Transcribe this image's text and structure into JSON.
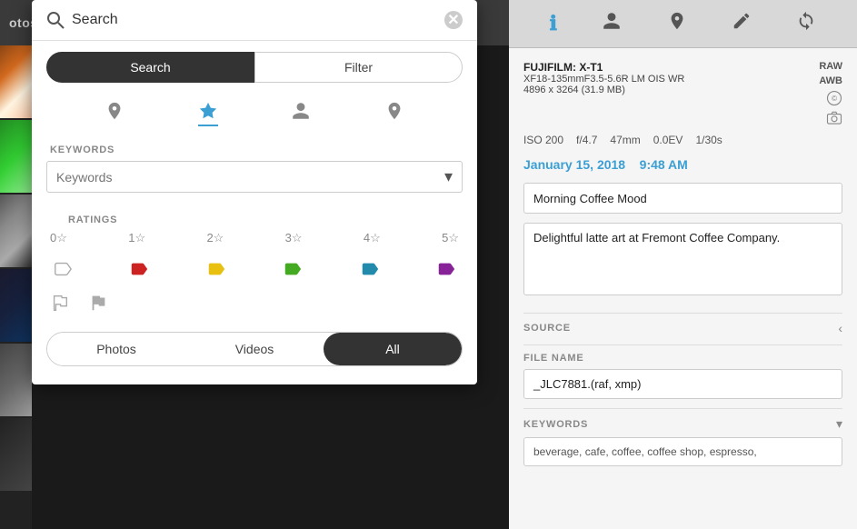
{
  "app": {
    "title": "otos"
  },
  "search_overlay": {
    "placeholder": "Search",
    "tabs": [
      {
        "label": "Search",
        "active": true
      },
      {
        "label": "Filter",
        "active": false
      }
    ],
    "filter_icons": [
      {
        "name": "pin",
        "symbol": "📌",
        "active": false
      },
      {
        "name": "star",
        "symbol": "★",
        "active": true
      },
      {
        "name": "person",
        "symbol": "👤",
        "active": false
      },
      {
        "name": "location",
        "symbol": "📍",
        "active": false
      }
    ],
    "keywords_section": {
      "label": "KEYWORDS",
      "placeholder": "Keywords"
    },
    "ratings_section": {
      "label": "RATINGS",
      "items": [
        "0☆",
        "1☆",
        "2☆",
        "3☆",
        "4☆",
        "5☆"
      ]
    },
    "color_labels": [
      {
        "color": "none",
        "label": "no color"
      },
      {
        "color": "#cc2222",
        "label": "red"
      },
      {
        "color": "#e8c010",
        "label": "yellow"
      },
      {
        "color": "#44aa22",
        "label": "green"
      },
      {
        "color": "#228aaa",
        "label": "teal"
      },
      {
        "color": "#882299",
        "label": "purple"
      }
    ],
    "flags": [
      {
        "type": "unflagged"
      },
      {
        "type": "flagged"
      }
    ],
    "media_types": [
      {
        "label": "Photos",
        "active": false
      },
      {
        "label": "Videos",
        "active": false
      },
      {
        "label": "All",
        "active": true
      }
    ]
  },
  "right_panel": {
    "toolbar_icons": [
      {
        "name": "info",
        "symbol": "ℹ",
        "active": true
      },
      {
        "name": "person",
        "symbol": "👤",
        "active": false
      },
      {
        "name": "location",
        "symbol": "📍",
        "active": false
      },
      {
        "name": "edit",
        "symbol": "✏",
        "active": false
      },
      {
        "name": "sync",
        "symbol": "⟳",
        "active": false
      }
    ],
    "camera": {
      "model": "FUJIFILM: X-T1",
      "lens": "XF18-135mmF3.5-5.6R LM OIS WR",
      "dimensions": "4896 x 3264 (31.9 MB)",
      "raw": "RAW",
      "awb": "AWB"
    },
    "exif": {
      "iso": "ISO 200",
      "aperture": "f/4.7",
      "focal": "47mm",
      "ev": "0.0EV",
      "shutter": "1/30s"
    },
    "date": "January 15, 2018",
    "time": "9:48 AM",
    "title_field": "Morning Coffee Mood",
    "description_field": "Delightful latte art at Fremont Coffee Company.",
    "source_section": "SOURCE",
    "filename_section": "FILE NAME",
    "filename": "_JLC7881.(raf, xmp)",
    "keywords_section_label": "KEYWORDS",
    "keywords_value": "beverage, cafe, coffee, coffee shop, espresso,"
  }
}
